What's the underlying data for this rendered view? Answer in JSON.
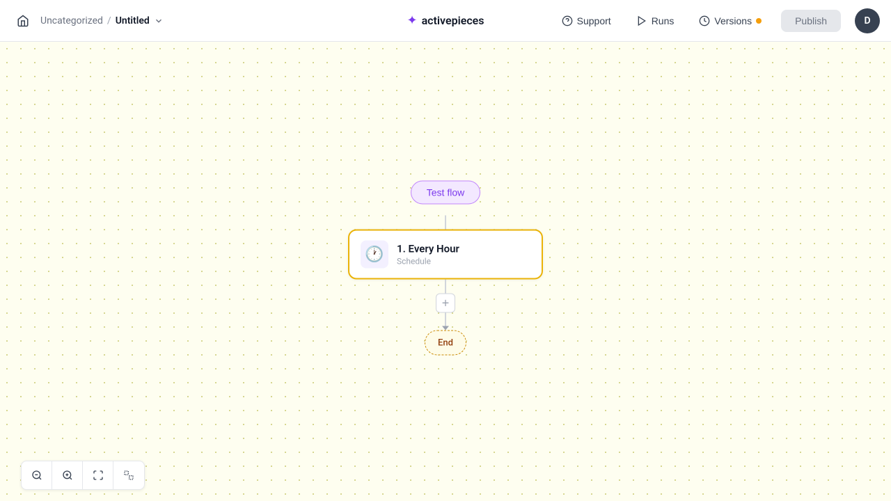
{
  "header": {
    "home_label": "Home",
    "breadcrumb_parent": "Uncategorized",
    "breadcrumb_separator": "/",
    "breadcrumb_current": "Untitled",
    "logo_icon": "⬡",
    "logo_text": "activepieces",
    "support_label": "Support",
    "runs_label": "Runs",
    "versions_label": "Versions",
    "publish_label": "Publish",
    "avatar_letter": "D"
  },
  "canvas": {
    "test_flow_label": "Test flow",
    "step": {
      "number": "1.",
      "name": "Every Hour",
      "title": "1. Every Hour",
      "subtitle": "Schedule",
      "icon": "🕐"
    },
    "add_icon": "+",
    "end_label": "End"
  },
  "zoom_controls": {
    "zoom_out_icon": "−",
    "zoom_in_icon": "+",
    "zoom_fit_icon": "⊡"
  }
}
